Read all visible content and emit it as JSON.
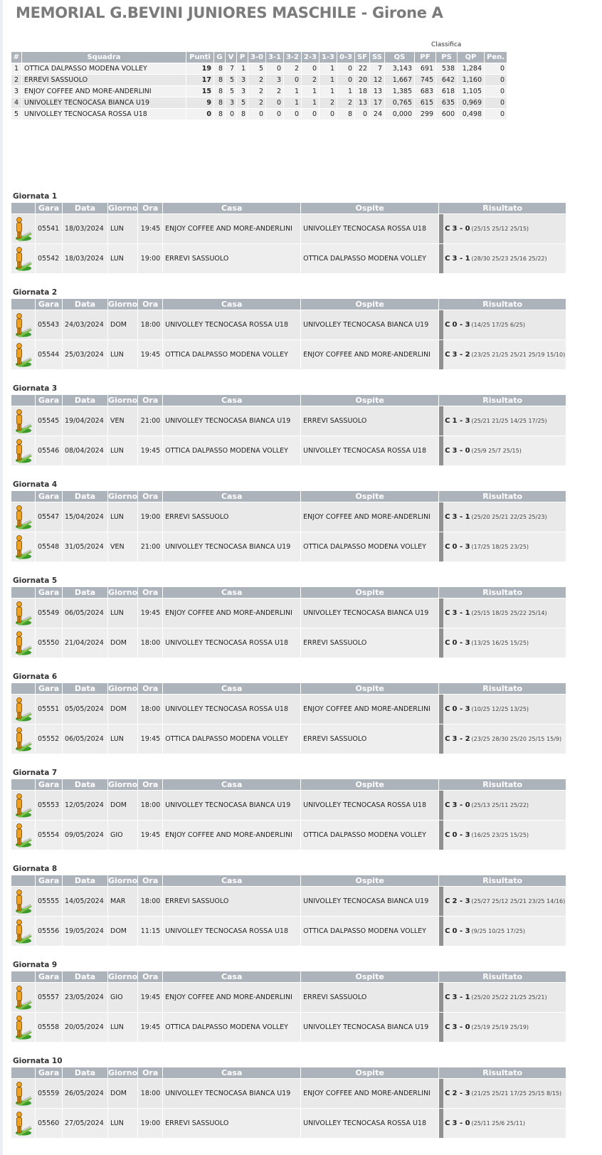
{
  "page": {
    "title": "MEMORIAL G.BEVINI JUNIORES MASCHILE - Girone A",
    "standings_caption": "Classifica"
  },
  "standings": {
    "headers": [
      "#",
      "Squadra",
      "Punti",
      "G",
      "V",
      "P",
      "3-0",
      "3-1",
      "3-2",
      "2-3",
      "1-3",
      "0-3",
      "SF",
      "SS",
      "QS",
      "PF",
      "PS",
      "QP",
      "Pen."
    ],
    "rows": [
      [
        "1",
        "OTTICA DALPASSO MODENA VOLLEY",
        "19",
        "8",
        "7",
        "1",
        "5",
        "0",
        "2",
        "0",
        "1",
        "0",
        "22",
        "7",
        "3,143",
        "691",
        "538",
        "1,284",
        "0"
      ],
      [
        "2",
        "ERREVI SASSUOLO",
        "17",
        "8",
        "5",
        "3",
        "2",
        "3",
        "0",
        "2",
        "1",
        "0",
        "20",
        "12",
        "1,667",
        "745",
        "642",
        "1,160",
        "0"
      ],
      [
        "3",
        "ENJOY COFFEE AND MORE-ANDERLINI",
        "15",
        "8",
        "5",
        "3",
        "2",
        "2",
        "1",
        "1",
        "1",
        "1",
        "18",
        "13",
        "1,385",
        "683",
        "618",
        "1,105",
        "0"
      ],
      [
        "4",
        "UNIVOLLEY TECNOCASA BIANCA U19",
        "9",
        "8",
        "3",
        "5",
        "2",
        "0",
        "1",
        "1",
        "2",
        "2",
        "13",
        "17",
        "0,765",
        "615",
        "635",
        "0,969",
        "0"
      ],
      [
        "5",
        "UNIVOLLEY TECNOCASA ROSSA U18",
        "0",
        "8",
        "0",
        "8",
        "0",
        "0",
        "0",
        "0",
        "0",
        "8",
        "0",
        "24",
        "0,000",
        "299",
        "600",
        "0,498",
        "0"
      ]
    ]
  },
  "schedule": {
    "headers": [
      "",
      "Gara",
      "Data",
      "Giorno",
      "Ora",
      "Casa",
      "Ospite",
      "Risultato"
    ],
    "result_prefix": "C",
    "icon": "referee-icon",
    "rounds": [
      {
        "title": "Giornata 1",
        "matches": [
          {
            "gara": "05541",
            "data": "18/03/2024",
            "giorno": "LUN",
            "ora": "19:45",
            "casa": "ENJOY COFFEE AND MORE-ANDERLINI",
            "ospite": "UNIVOLLEY TECNOCASA ROSSA U18",
            "score": "3 - 0",
            "sets": "(25/15 25/12 25/15)"
          },
          {
            "gara": "05542",
            "data": "18/03/2024",
            "giorno": "LUN",
            "ora": "19:00",
            "casa": "ERREVI SASSUOLO",
            "ospite": "OTTICA DALPASSO MODENA VOLLEY",
            "score": "3 - 1",
            "sets": "(28/30 25/23 25/16 25/22)"
          }
        ]
      },
      {
        "title": "Giornata 2",
        "matches": [
          {
            "gara": "05543",
            "data": "24/03/2024",
            "giorno": "DOM",
            "ora": "18:00",
            "casa": "UNIVOLLEY TECNOCASA ROSSA U18",
            "ospite": "UNIVOLLEY TECNOCASA BIANCA U19",
            "score": "0 - 3",
            "sets": "(14/25 17/25 6/25)"
          },
          {
            "gara": "05544",
            "data": "25/03/2024",
            "giorno": "LUN",
            "ora": "19:45",
            "casa": "OTTICA DALPASSO MODENA VOLLEY",
            "ospite": "ENJOY COFFEE AND MORE-ANDERLINI",
            "score": "3 - 2",
            "sets": "(23/25 21/25 25/21 25/19 15/10)"
          }
        ]
      },
      {
        "title": "Giornata 3",
        "matches": [
          {
            "gara": "05545",
            "data": "19/04/2024",
            "giorno": "VEN",
            "ora": "21:00",
            "casa": "UNIVOLLEY TECNOCASA BIANCA U19",
            "ospite": "ERREVI SASSUOLO",
            "score": "1 - 3",
            "sets": "(25/21 21/25 14/25 17/25)"
          },
          {
            "gara": "05546",
            "data": "08/04/2024",
            "giorno": "LUN",
            "ora": "19:45",
            "casa": "OTTICA DALPASSO MODENA VOLLEY",
            "ospite": "UNIVOLLEY TECNOCASA ROSSA U18",
            "score": "3 - 0",
            "sets": "(25/9 25/7 25/15)"
          }
        ]
      },
      {
        "title": "Giornata 4",
        "matches": [
          {
            "gara": "05547",
            "data": "15/04/2024",
            "giorno": "LUN",
            "ora": "19:00",
            "casa": "ERREVI SASSUOLO",
            "ospite": "ENJOY COFFEE AND MORE-ANDERLINI",
            "score": "3 - 1",
            "sets": "(25/20 25/21 22/25 25/23)"
          },
          {
            "gara": "05548",
            "data": "31/05/2024",
            "giorno": "VEN",
            "ora": "21:00",
            "casa": "UNIVOLLEY TECNOCASA BIANCA U19",
            "ospite": "OTTICA DALPASSO MODENA VOLLEY",
            "score": "0 - 3",
            "sets": "(17/25 18/25 23/25)"
          }
        ]
      },
      {
        "title": "Giornata 5",
        "matches": [
          {
            "gara": "05549",
            "data": "06/05/2024",
            "giorno": "LUN",
            "ora": "19:45",
            "casa": "ENJOY COFFEE AND MORE-ANDERLINI",
            "ospite": "UNIVOLLEY TECNOCASA BIANCA U19",
            "score": "3 - 1",
            "sets": "(25/15 18/25 25/22 25/14)"
          },
          {
            "gara": "05550",
            "data": "21/04/2024",
            "giorno": "DOM",
            "ora": "18:00",
            "casa": "UNIVOLLEY TECNOCASA ROSSA U18",
            "ospite": "ERREVI SASSUOLO",
            "score": "0 - 3",
            "sets": "(13/25 16/25 15/25)"
          }
        ]
      },
      {
        "title": "Giornata 6",
        "matches": [
          {
            "gara": "05551",
            "data": "05/05/2024",
            "giorno": "DOM",
            "ora": "18:00",
            "casa": "UNIVOLLEY TECNOCASA ROSSA U18",
            "ospite": "ENJOY COFFEE AND MORE-ANDERLINI",
            "score": "0 - 3",
            "sets": "(10/25 12/25 13/25)"
          },
          {
            "gara": "05552",
            "data": "06/05/2024",
            "giorno": "LUN",
            "ora": "19:45",
            "casa": "OTTICA DALPASSO MODENA VOLLEY",
            "ospite": "ERREVI SASSUOLO",
            "score": "3 - 2",
            "sets": "(23/25 28/30 25/20 25/15 15/9)"
          }
        ]
      },
      {
        "title": "Giornata 7",
        "matches": [
          {
            "gara": "05553",
            "data": "12/05/2024",
            "giorno": "DOM",
            "ora": "18:00",
            "casa": "UNIVOLLEY TECNOCASA BIANCA U19",
            "ospite": "UNIVOLLEY TECNOCASA ROSSA U18",
            "score": "3 - 0",
            "sets": "(25/13 25/11 25/22)"
          },
          {
            "gara": "05554",
            "data": "09/05/2024",
            "giorno": "GIO",
            "ora": "19:45",
            "casa": "ENJOY COFFEE AND MORE-ANDERLINI",
            "ospite": "OTTICA DALPASSO MODENA VOLLEY",
            "score": "0 - 3",
            "sets": "(16/25 23/25 15/25)"
          }
        ]
      },
      {
        "title": "Giornata 8",
        "matches": [
          {
            "gara": "05555",
            "data": "14/05/2024",
            "giorno": "MAR",
            "ora": "18:00",
            "casa": "ERREVI SASSUOLO",
            "ospite": "UNIVOLLEY TECNOCASA BIANCA U19",
            "score": "2 - 3",
            "sets": "(25/27 25/12 25/21 23/25 14/16)"
          },
          {
            "gara": "05556",
            "data": "19/05/2024",
            "giorno": "DOM",
            "ora": "11:15",
            "casa": "UNIVOLLEY TECNOCASA ROSSA U18",
            "ospite": "OTTICA DALPASSO MODENA VOLLEY",
            "score": "0 - 3",
            "sets": "(9/25 10/25 17/25)"
          }
        ]
      },
      {
        "title": "Giornata 9",
        "matches": [
          {
            "gara": "05557",
            "data": "23/05/2024",
            "giorno": "GIO",
            "ora": "19:45",
            "casa": "ENJOY COFFEE AND MORE-ANDERLINI",
            "ospite": "ERREVI SASSUOLO",
            "score": "3 - 1",
            "sets": "(25/20 25/22 21/25 25/21)"
          },
          {
            "gara": "05558",
            "data": "20/05/2024",
            "giorno": "LUN",
            "ora": "19:45",
            "casa": "OTTICA DALPASSO MODENA VOLLEY",
            "ospite": "UNIVOLLEY TECNOCASA BIANCA U19",
            "score": "3 - 0",
            "sets": "(25/19 25/19 25/19)"
          }
        ]
      },
      {
        "title": "Giornata 10",
        "matches": [
          {
            "gara": "05559",
            "data": "26/05/2024",
            "giorno": "DOM",
            "ora": "18:00",
            "casa": "UNIVOLLEY TECNOCASA BIANCA U19",
            "ospite": "ENJOY COFFEE AND MORE-ANDERLINI",
            "score": "2 - 3",
            "sets": "(21/25 25/21 17/25 25/15 8/15)"
          },
          {
            "gara": "05560",
            "data": "27/05/2024",
            "giorno": "LUN",
            "ora": "19:00",
            "casa": "ERREVI SASSUOLO",
            "ospite": "UNIVOLLEY TECNOCASA ROSSA U18",
            "score": "3 - 0",
            "sets": "(25/11 25/6 25/11)"
          }
        ]
      }
    ]
  }
}
